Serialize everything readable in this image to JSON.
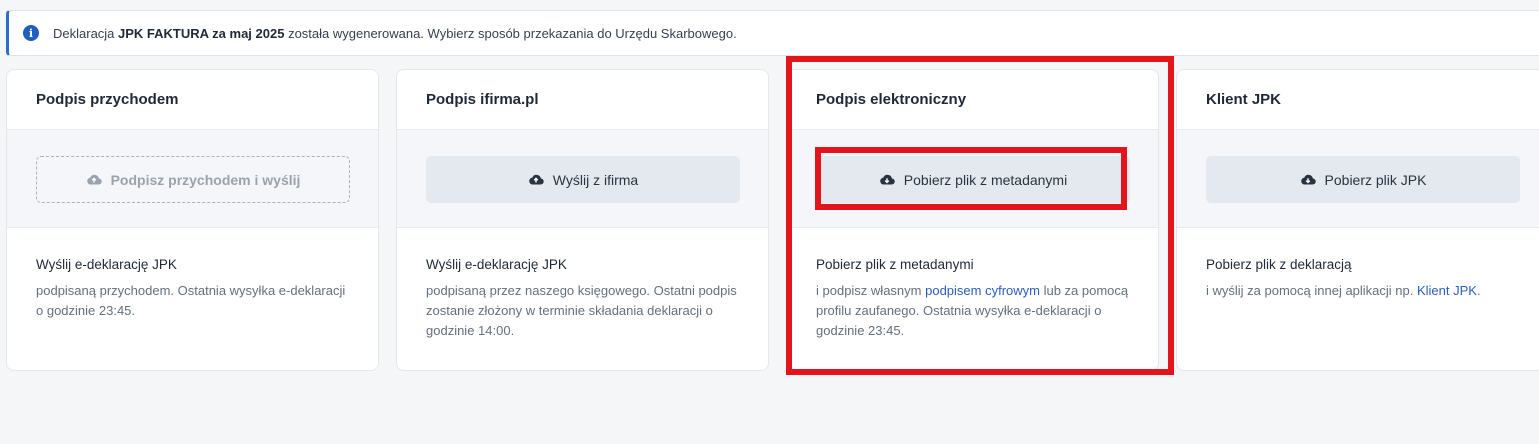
{
  "alert": {
    "icon": "info-icon",
    "prefix": "Deklaracja ",
    "bold": "JPK FAKTURA za maj 2025",
    "suffix": " została wygenerowana. Wybierz sposób przekazania do Urzędu Skarbowego."
  },
  "cards": [
    {
      "title": "Podpis przychodem",
      "button": "Podpisz przychodem i wyślij",
      "body_title": "Wyślij e-deklarację JPK",
      "body_text": "podpisaną przychodem. Ostatnia wysyłka e-deklaracji o godzinie 23:45."
    },
    {
      "title": "Podpis ifirma.pl",
      "button": "Wyślij z ifirma",
      "body_title": "Wyślij e-deklarację JPK",
      "body_text": "podpisaną przez naszego księgowego. Ostatni podpis zostanie złożony w terminie składania deklaracji o godzinie 14:00."
    },
    {
      "title": "Podpis elektroniczny",
      "button": "Pobierz plik z metadanymi",
      "body_title": "Pobierz plik z metadanymi",
      "body_text_before": "i podpisz własnym ",
      "body_link": "podpisem cyfrowym",
      "body_text_after": " lub za pomocą profilu zaufanego. Ostatnia wysyłka e-deklaracji o godzinie 23:45."
    },
    {
      "title": "Klient JPK",
      "button": "Pobierz plik JPK",
      "body_title": "Pobierz plik z deklaracją",
      "body_text_before": "i wyślij za pomocą innej aplikacji np. ",
      "body_link": "Klient JPK",
      "body_text_after": "."
    }
  ],
  "colors": {
    "accent": "#2d6bcf",
    "link": "#2a5fbf",
    "highlight": "#e3141b"
  }
}
